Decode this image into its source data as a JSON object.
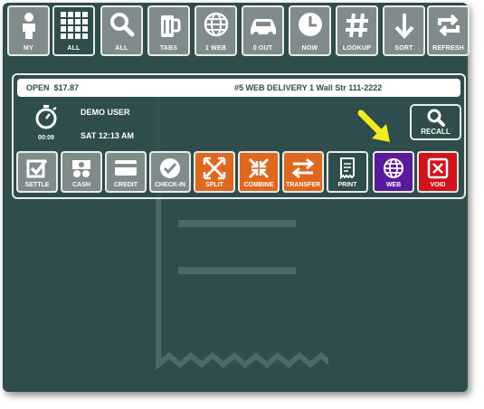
{
  "toolbar": {
    "buttons": [
      {
        "label": "MY",
        "icon": "person-icon"
      },
      {
        "label": "ALL",
        "icon": "grid-icon",
        "active": true
      },
      {
        "label": "ALL",
        "icon": "search-icon"
      },
      {
        "label": "TABS",
        "icon": "beer-mug-icon"
      },
      {
        "label": "1 WEB",
        "icon": "globe-icon"
      },
      {
        "label": "0 OUT",
        "icon": "car-icon"
      },
      {
        "label": "NOW",
        "icon": "clock-icon"
      },
      {
        "label": "LOOKUP",
        "icon": "hash-icon"
      },
      {
        "label": "SORT",
        "icon": "arrow-down-icon"
      },
      {
        "label": "REFRESH",
        "icon": "refresh-icon"
      }
    ]
  },
  "order": {
    "status": "OPEN",
    "amount": "$17.87",
    "description": "#5  WEB DELIVERY 1 Wall Str 111-2222",
    "timer": "00:09",
    "user": "DEMO USER",
    "datetime": "SAT 12:13 AM"
  },
  "recall": {
    "label": "RECALL",
    "icon": "search-icon"
  },
  "actions": [
    {
      "label": "SETTLE",
      "icon": "checkbox-icon",
      "color": "#7f8c8b"
    },
    {
      "label": "CASH",
      "icon": "cash-icon",
      "color": "#7f8c8b"
    },
    {
      "label": "CREDIT",
      "icon": "credit-card-icon",
      "color": "#7f8c8b"
    },
    {
      "label": "CHECK-IN",
      "icon": "check-circle-icon",
      "color": "#7f8c8b"
    },
    {
      "label": "SPLIT",
      "icon": "split-icon",
      "color": "#e0681e"
    },
    {
      "label": "COMBINE",
      "icon": "combine-icon",
      "color": "#e0681e"
    },
    {
      "label": "TRANSFER",
      "icon": "transfer-icon",
      "color": "#e0681e"
    },
    {
      "label": "PRINT",
      "icon": "receipt-icon",
      "color": "#2f4d4c"
    },
    {
      "label": "WEB",
      "icon": "globe-icon",
      "color": "#5a1a9c"
    },
    {
      "label": "VOID",
      "icon": "close-icon",
      "color": "#d3121a"
    }
  ],
  "colors": {
    "background": "#2f4d4c",
    "highlight_arrow": "#f2ec1c"
  }
}
